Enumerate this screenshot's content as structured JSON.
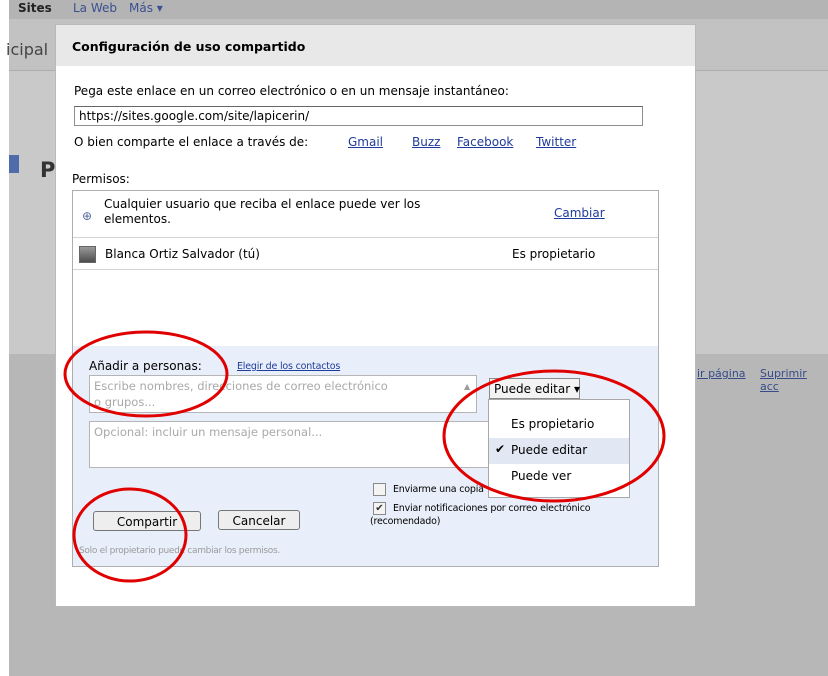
{
  "background": {
    "nav": {
      "sites": "Sites",
      "web": "La Web",
      "mas": "Más ▾"
    },
    "header_fragment": "icipal",
    "page_initial": "P",
    "links": [
      "ir página",
      "Suprimir acc"
    ]
  },
  "dialog": {
    "title": "Configuración de uso compartido",
    "link_prompt": "Pega este enlace en un correo electrónico o en un mensaje instantáneo:",
    "link_url": "https://sites.google.com/site/lapicerin/",
    "share_via_label": "O bien comparte el enlace a través de:",
    "share_services": [
      "Gmail",
      "Buzz",
      "Facebook",
      "Twitter"
    ],
    "permissions_label": "Permisos:",
    "public_line1": "Cualquier usuario que reciba el enlace puede ver los",
    "public_line2": "elementos.",
    "change_link": "Cambiar",
    "owner_name": "Blanca Ortiz Salvador (tú)",
    "owner_role": "Es propietario",
    "add_people_label": "Añadir a personas:",
    "choose_contacts": "Elegir de los contactos",
    "names_placeholder_line1": "Escribe nombres, direcciones de correo electrónico",
    "names_placeholder_line2": "o grupos...",
    "message_placeholder": "Opcional: incluir un mensaje personal...",
    "role_selected": "Puede editar ▾",
    "role_options": [
      "Es propietario",
      "Puede editar",
      "Puede ver"
    ],
    "role_selected_index": 1,
    "send_copy_label": "Enviarme una copia",
    "send_copy_checked": false,
    "notify_line1": "Enviar notificaciones por correo electrónico",
    "notify_line2": "(recomendado)",
    "notify_checked": true,
    "share_button": "Compartir",
    "cancel_button": "Cancelar",
    "owner_note": "Solo el propietario puede cambiar los permisos."
  },
  "annotation_color": "#e00000"
}
